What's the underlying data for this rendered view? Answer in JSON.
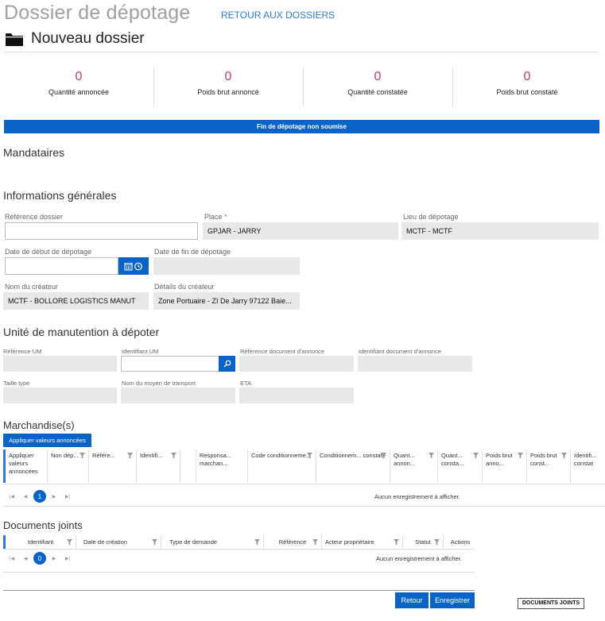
{
  "header": {
    "title": "Dossier de dépotage",
    "back_link": "RETOUR AUX DOSSIERS",
    "subtitle": "Nouveau dossier"
  },
  "stats": [
    {
      "value": "0",
      "label": "Quantité annoncée"
    },
    {
      "value": "0",
      "label": "Poids brut annoncé"
    },
    {
      "value": "0",
      "label": "Quantité constatée"
    },
    {
      "value": "0",
      "label": "Poids brut constaté"
    }
  ],
  "banner": "Fin de dépotage non soumise",
  "sections": {
    "mandataires": "Mandataires",
    "informations": "Informations générales",
    "unite": "Unité de manutention à dépoter",
    "marchandises": "Marchandise(s)",
    "documents": "Documents joints"
  },
  "info": {
    "ref_dossier_label": "Référence dossier",
    "ref_dossier_value": "",
    "place_label": "Place",
    "place_required": "*",
    "place_value": "GPJAR - JARRY",
    "lieu_label": "Lieu de dépotage",
    "lieu_value": "MCTF - MCTF",
    "date_debut_label": "Date de début de dépotage",
    "date_debut_value": "",
    "date_fin_label": "Date de fin de dépotage",
    "date_fin_value": "",
    "createur_label": "Nom du créateur",
    "createur_value": "MCTF - BOLLORE LOGISTICS MANUT",
    "details_label": "Détails du créateur",
    "details_value": "Zone Portuaire - ZI De Jarry 97122 Baie..."
  },
  "um": {
    "ref_um": "Référence UM",
    "id_um": "Identifiant UM",
    "ref_doc": "Référence document d'annonce",
    "id_doc": "Identifiant document d'annonce",
    "taille": "Taille type",
    "moyen": "Nom du moyen de transport",
    "eta": "ETA"
  },
  "marchandises": {
    "apply_button": "Appliquer valeurs annoncées",
    "columns": [
      "Appliquer valeurs annoncées",
      "Non dép...",
      "Référe...",
      "Identifi...",
      "",
      "Responsa... marchan...",
      "Code conditionneme...",
      "Conditionnem... constaté",
      "Quant... annon...",
      "Quant... consta...",
      "Poids brut anno...",
      "Poids brut const...",
      "Identifi... constat"
    ],
    "page": "1",
    "no_records": "Aucun enregistrement à afficher."
  },
  "documents": {
    "columns": [
      "Identifiant",
      "Date de création",
      "Type de demande",
      "Référence",
      "Acteur propriétaire",
      "Statut",
      "Actions"
    ],
    "page": "0",
    "no_records": "Aucun enregistrement à afficher."
  },
  "footer": {
    "retour": "Retour",
    "enregistrer": "Enregistrer",
    "documents_joints": "DOCUMENTS JOINTS"
  },
  "colors": {
    "accent": "#0a64c8",
    "stat_value": "#c0397a",
    "link": "#2b7cd3"
  }
}
